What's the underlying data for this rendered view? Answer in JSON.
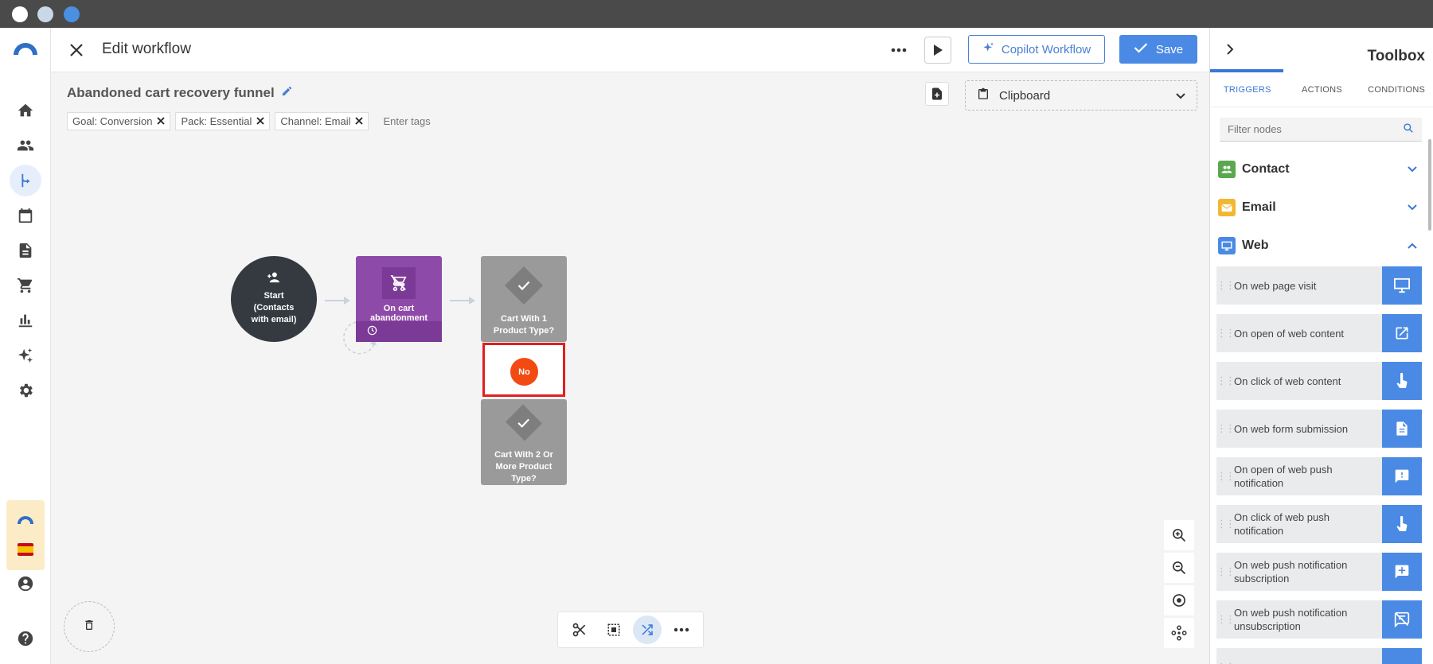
{
  "window": {
    "dots": [
      "#ffffff",
      "#c8d8e6",
      "#4a8fe0"
    ]
  },
  "nav": {
    "brand": "webeyez logo",
    "items": [
      "home-icon",
      "contacts-icon",
      "workflows-icon",
      "calendar-icon",
      "content-icon",
      "commerce-icon",
      "analytics-icon",
      "ai-icon",
      "settings-icon"
    ],
    "extension_flag": "es",
    "profile": "account-icon",
    "help": "help-icon"
  },
  "header": {
    "title": "Edit workflow",
    "copilot_label": "Copilot Workflow",
    "save_label": "Save"
  },
  "canvas": {
    "workflow_name": "Abandoned cart recovery funnel",
    "tags": [
      "Goal: Conversion",
      "Pack: Essential",
      "Channel: Email"
    ],
    "tag_placeholder": "Enter tags",
    "clipboard_label": "Clipboard",
    "nodes": {
      "start": "Start (Contacts with email)",
      "cart": "On cart abandonment",
      "cond1": "Cart With 1 Product Type?",
      "cond2": "Cart With 2 Or More Product Type?",
      "no_label": "No"
    }
  },
  "toolbox": {
    "title": "Toolbox",
    "tabs": [
      "TRIGGERS",
      "ACTIONS",
      "CONDITIONS"
    ],
    "active_tab": "TRIGGERS",
    "search_placeholder": "Filter nodes",
    "sections": [
      {
        "label": "Contact",
        "color": "#5aa84e",
        "expanded": false
      },
      {
        "label": "Email",
        "color": "#f2b731",
        "expanded": false
      },
      {
        "label": "Web",
        "color": "#4a8ae4",
        "expanded": true
      }
    ],
    "items": [
      "On web page visit",
      "On open of web content",
      "On click of web content",
      "On web form submission",
      "On open of web push notification",
      "On click of web push notification",
      "On web push notification subscription",
      "On web push notification unsubscription"
    ]
  }
}
